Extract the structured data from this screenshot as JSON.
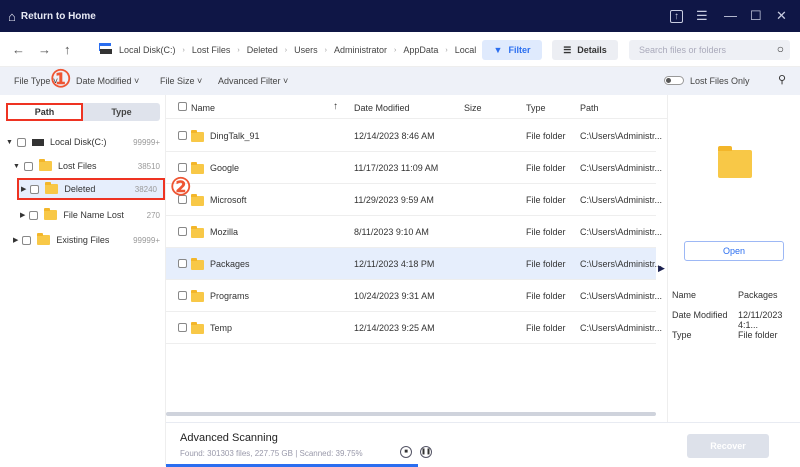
{
  "titlebar": {
    "home_label": "Return to Home"
  },
  "breadcrumb": [
    "Local Disk(C:)",
    "Lost Files",
    "Deleted",
    "Users",
    "Administrator",
    "AppData",
    "Local"
  ],
  "toolbar": {
    "filter_label": "Filter",
    "details_label": "Details",
    "search_placeholder": "Search files or folders"
  },
  "filters": {
    "file_type": "File Type",
    "date_modified": "Date Modified",
    "file_size": "File Size",
    "advanced": "Advanced Filter",
    "lost_only": "Lost Files Only"
  },
  "tabs": {
    "path": "Path",
    "type": "Type"
  },
  "tree": [
    {
      "label": "Local Disk(C:)",
      "count": "99999+"
    },
    {
      "label": "Lost Files",
      "count": "38510"
    },
    {
      "label": "Deleted",
      "count": "38240"
    },
    {
      "label": "File Name Lost",
      "count": "270"
    },
    {
      "label": "Existing Files",
      "count": "99999+"
    }
  ],
  "annotations": {
    "one": "①",
    "two": "②"
  },
  "table": {
    "headers": {
      "name": "Name",
      "date": "Date Modified",
      "size": "Size",
      "type": "Type",
      "path": "Path"
    },
    "rows": [
      {
        "name": "DingTalk_91",
        "date": "12/14/2023 8:46 AM",
        "type": "File folder",
        "path": "C:\\Users\\Administr..."
      },
      {
        "name": "Google",
        "date": "11/17/2023 11:09 AM",
        "type": "File folder",
        "path": "C:\\Users\\Administr..."
      },
      {
        "name": "Microsoft",
        "date": "11/29/2023 9:59 AM",
        "type": "File folder",
        "path": "C:\\Users\\Administr..."
      },
      {
        "name": "Mozilla",
        "date": "8/11/2023 9:10 AM",
        "type": "File folder",
        "path": "C:\\Users\\Administr..."
      },
      {
        "name": "Packages",
        "date": "12/11/2023 4:18 PM",
        "type": "File folder",
        "path": "C:\\Users\\Administr..."
      },
      {
        "name": "Programs",
        "date": "10/24/2023 9:31 AM",
        "type": "File folder",
        "path": "C:\\Users\\Administr..."
      },
      {
        "name": "Temp",
        "date": "12/14/2023 9:25 AM",
        "type": "File folder",
        "path": "C:\\Users\\Administr..."
      }
    ]
  },
  "details": {
    "open_label": "Open",
    "labels": [
      "Name",
      "Date Modified",
      "Type"
    ],
    "values": [
      "Packages",
      "12/11/2023 4:1...",
      "File folder"
    ]
  },
  "status": {
    "title": "Advanced Scanning",
    "found": "Found: 301303 files, 227.75 GB",
    "scanned": "Scanned: 39.75%",
    "progress": 0.3975,
    "recover_label": "Recover"
  }
}
